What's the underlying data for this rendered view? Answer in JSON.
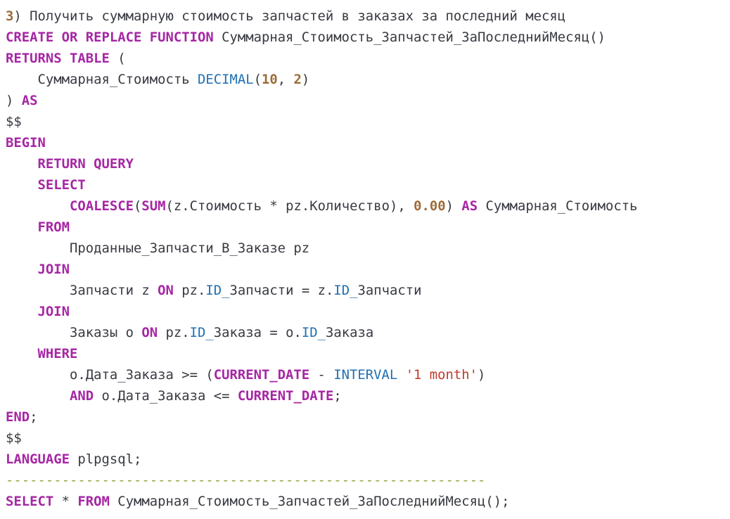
{
  "code": {
    "lines": [
      [
        {
          "t": "3",
          "c": "num"
        },
        {
          "t": ") Получить суммарную стоимость запчастей в заказах за последний месяц",
          "c": "tx"
        }
      ],
      [
        {
          "t": "CREATE OR REPLACE FUNCTION",
          "c": "kw"
        },
        {
          "t": " Суммарная_Стоимость_Запчастей_ЗаПоследнийМесяц()",
          "c": "tx"
        }
      ],
      [
        {
          "t": "RETURNS TABLE",
          "c": "kw"
        },
        {
          "t": " (",
          "c": "tx"
        }
      ],
      [
        {
          "t": "    Суммарная_Стоимость ",
          "c": "tx"
        },
        {
          "t": "DECIMAL",
          "c": "ty"
        },
        {
          "t": "(",
          "c": "tx"
        },
        {
          "t": "10",
          "c": "num"
        },
        {
          "t": ", ",
          "c": "tx"
        },
        {
          "t": "2",
          "c": "num"
        },
        {
          "t": ")",
          "c": "tx"
        }
      ],
      [
        {
          "t": ") ",
          "c": "tx"
        },
        {
          "t": "AS",
          "c": "kw"
        }
      ],
      [
        {
          "t": "$$",
          "c": "tx"
        }
      ],
      [
        {
          "t": "BEGIN",
          "c": "kw"
        }
      ],
      [
        {
          "t": "    ",
          "c": "tx"
        },
        {
          "t": "RETURN QUERY",
          "c": "kw"
        }
      ],
      [
        {
          "t": "    ",
          "c": "tx"
        },
        {
          "t": "SELECT",
          "c": "kw"
        }
      ],
      [
        {
          "t": "        ",
          "c": "tx"
        },
        {
          "t": "COALESCE",
          "c": "kw"
        },
        {
          "t": "(",
          "c": "tx"
        },
        {
          "t": "SUM",
          "c": "kw"
        },
        {
          "t": "(z.Стоимость * pz.Количество), ",
          "c": "tx"
        },
        {
          "t": "0.00",
          "c": "num"
        },
        {
          "t": ") ",
          "c": "tx"
        },
        {
          "t": "AS",
          "c": "kw"
        },
        {
          "t": " Суммарная_Стоимость",
          "c": "tx"
        }
      ],
      [
        {
          "t": "    ",
          "c": "tx"
        },
        {
          "t": "FROM",
          "c": "kw"
        }
      ],
      [
        {
          "t": "        Проданные_Запчасти_В_Заказе pz",
          "c": "tx"
        }
      ],
      [
        {
          "t": "    ",
          "c": "tx"
        },
        {
          "t": "JOIN",
          "c": "kw"
        }
      ],
      [
        {
          "t": "        Запчасти z ",
          "c": "tx"
        },
        {
          "t": "ON",
          "c": "kw"
        },
        {
          "t": " pz.",
          "c": "tx"
        },
        {
          "t": "ID_",
          "c": "ty"
        },
        {
          "t": "Запчасти = z.",
          "c": "tx"
        },
        {
          "t": "ID_",
          "c": "ty"
        },
        {
          "t": "Запчасти",
          "c": "tx"
        }
      ],
      [
        {
          "t": "    ",
          "c": "tx"
        },
        {
          "t": "JOIN",
          "c": "kw"
        }
      ],
      [
        {
          "t": "        Заказы o ",
          "c": "tx"
        },
        {
          "t": "ON",
          "c": "kw"
        },
        {
          "t": " pz.",
          "c": "tx"
        },
        {
          "t": "ID_",
          "c": "ty"
        },
        {
          "t": "Заказа = o.",
          "c": "tx"
        },
        {
          "t": "ID_",
          "c": "ty"
        },
        {
          "t": "Заказа",
          "c": "tx"
        }
      ],
      [
        {
          "t": "    ",
          "c": "tx"
        },
        {
          "t": "WHERE",
          "c": "kw"
        }
      ],
      [
        {
          "t": "        o.Дата_Заказа >= (",
          "c": "tx"
        },
        {
          "t": "CURRENT_DATE",
          "c": "kw"
        },
        {
          "t": " - ",
          "c": "tx"
        },
        {
          "t": "INTERVAL",
          "c": "ty"
        },
        {
          "t": " ",
          "c": "tx"
        },
        {
          "t": "'1 month'",
          "c": "str"
        },
        {
          "t": ")",
          "c": "tx"
        }
      ],
      [
        {
          "t": "        ",
          "c": "tx"
        },
        {
          "t": "AND",
          "c": "kw"
        },
        {
          "t": " o.Дата_Заказа <= ",
          "c": "tx"
        },
        {
          "t": "CURRENT_DATE",
          "c": "kw"
        },
        {
          "t": ";",
          "c": "tx"
        }
      ],
      [
        {
          "t": "END",
          "c": "kw"
        },
        {
          "t": ";",
          "c": "tx"
        }
      ],
      [
        {
          "t": "$$",
          "c": "tx"
        }
      ],
      [
        {
          "t": "LANGUAGE",
          "c": "kw"
        },
        {
          "t": " plpgsql;",
          "c": "tx"
        }
      ],
      [
        {
          "t": "------------------------------------------------------------",
          "c": "sep"
        }
      ],
      [
        {
          "t": "SELECT",
          "c": "kw"
        },
        {
          "t": " * ",
          "c": "tx"
        },
        {
          "t": "FROM",
          "c": "kw"
        },
        {
          "t": " Суммарная_Стоимость_Запчастей_ЗаПоследнийМесяц();",
          "c": "tx"
        }
      ]
    ]
  }
}
